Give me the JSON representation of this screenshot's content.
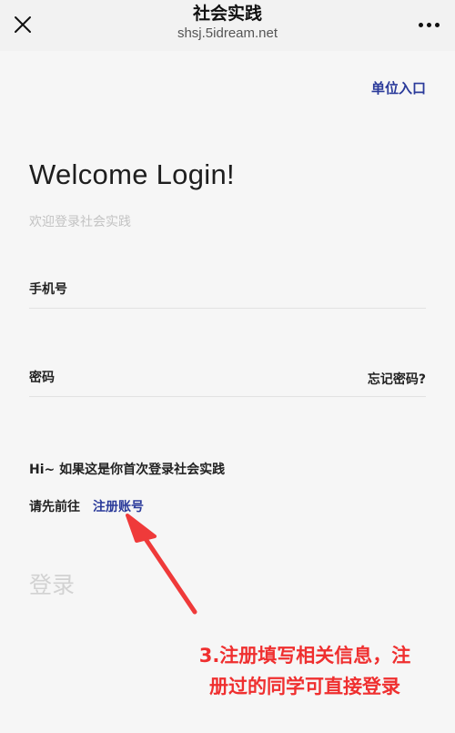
{
  "header": {
    "title": "社会实践",
    "subtitle": "shsj.5idream.net"
  },
  "unit_entry": "单位入口",
  "welcome": {
    "title": "Welcome Login!",
    "subtitle": "欢迎登录社会实践"
  },
  "form": {
    "phone_placeholder": "手机号",
    "password_placeholder": "密码",
    "forgot_label": "忘记密码?"
  },
  "hint": {
    "line1": "Hi~ 如果这是你首次登录社会实践",
    "line2": "请先前往",
    "register_label": "注册账号"
  },
  "login_label": "登录",
  "annotation": {
    "line1": "3.注册填写相关信息，注",
    "line2": "册过的同学可直接登录"
  },
  "colors": {
    "link": "#2a3a9a",
    "annotation": "#ef2f2f"
  }
}
